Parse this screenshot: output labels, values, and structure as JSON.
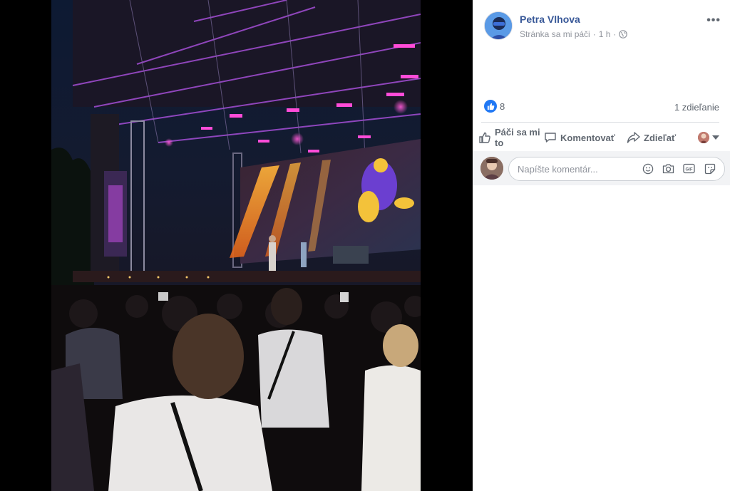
{
  "post": {
    "author": "Petra Vlhova",
    "subtitle": "Stránka sa mi páči",
    "separator": "·",
    "time": "1 h",
    "privacy_icon": "globe-icon",
    "more_label": "•••"
  },
  "reactions": {
    "like_count": "8",
    "shares": "1 zdieľanie"
  },
  "actions": {
    "like": "Páči sa mi to",
    "comment": "Komentovať",
    "share": "Zdieľať"
  },
  "comment_box": {
    "placeholder": "Napíšte komentár..."
  },
  "icons": {
    "emoji": "smiley-icon",
    "camera": "camera-icon",
    "gif": "gif-icon",
    "sticker": "sticker-icon"
  },
  "colors": {
    "author_link": "#385898",
    "like_blue": "#2078f4",
    "muted": "#606770",
    "comment_bg": "#f2f3f5"
  }
}
